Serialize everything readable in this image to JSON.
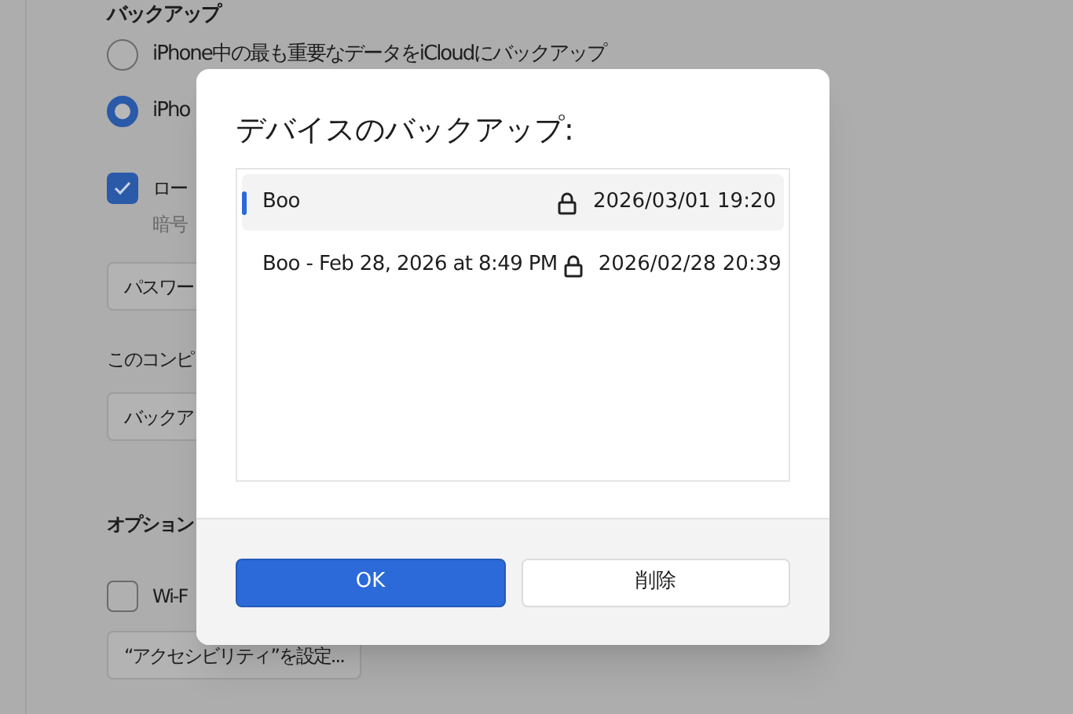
{
  "background": {
    "heading": "バックアップ",
    "radios": [
      {
        "label": "iPhone中の最も重要なデータをiCloudにバックアップ",
        "selected": false
      },
      {
        "label": "iPho",
        "selected": true
      }
    ],
    "encrypt": {
      "label": "ロー",
      "checked": true,
      "note": "暗号"
    },
    "password_button": "パスワー",
    "computer_label": "このコンピ",
    "backup_button": "バックア",
    "options_heading": "オプション",
    "wifi": {
      "label": "Wi-F",
      "checked": false
    },
    "accessibility_button": "“アクセシビリティ”を設定..."
  },
  "dialog": {
    "title": "デバイスのバックアップ:",
    "backups": [
      {
        "name": "Boo",
        "locked": true,
        "date": "2026/03/01 19:20",
        "selected": true
      },
      {
        "name": "Boo - Feb 28, 2026 at 8:49 PM",
        "locked": true,
        "date": "2026/02/28 20:39",
        "selected": false
      }
    ],
    "buttons": [
      {
        "label": "OK",
        "kind": "primary"
      },
      {
        "label": "削除",
        "kind": "secondary"
      }
    ]
  }
}
